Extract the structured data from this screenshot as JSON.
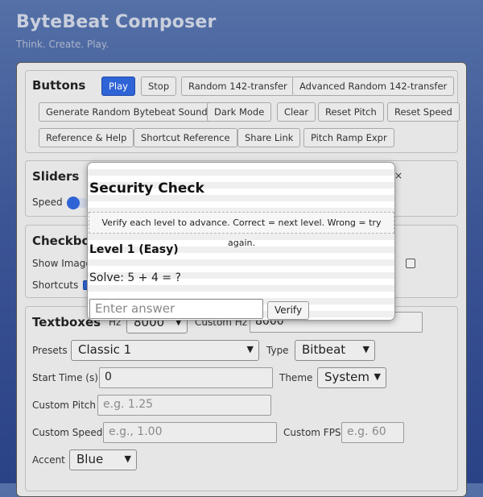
{
  "app": {
    "title": "ByteBeat Composer",
    "subtitle": "Think. Create. Play."
  },
  "buttons": {
    "title": "Buttons",
    "play": "Play",
    "stop": "Stop",
    "random142": "Random 142-transfer",
    "advanced_random142": "Advanced Random 142-transfer",
    "generate_random": "Generate Random Bytebeat Sound",
    "dark_mode": "Dark Mode",
    "clear": "Clear",
    "reset_pitch": "Reset Pitch",
    "reset_speed": "Reset Speed",
    "reference_help": "Reference & Help",
    "shortcut_reference": "Shortcut Reference",
    "share_link": "Share Link",
    "pitch_ramp": "Pitch Ramp Expr"
  },
  "sliders": {
    "title_visible": "Sliders",
    "speed_label": "Speed"
  },
  "checkboxes": {
    "title_visible": "Checkbo",
    "show_image_visible": "Show Image",
    "shortcuts": "Shortcuts",
    "shortcuts_checked": true
  },
  "textboxes": {
    "title": "Textboxes",
    "hz_partial": "Hz",
    "hz_value": "8000",
    "custom_hz_partial": "Custom Hz",
    "custom_hz_value": "8000",
    "presets_label": "Presets",
    "presets_value": "Classic 1",
    "type_label": "Type",
    "type_value": "Bitbeat",
    "start_time_label": "Start Time (s):",
    "start_time_value": "0",
    "theme_label": "Theme",
    "theme_value": "System",
    "custom_pitch_label": "Custom Pitch",
    "custom_pitch_placeholder": "e.g. 1.25",
    "custom_speed_label": "Custom Speed",
    "custom_speed_placeholder": "e.g., 1.00",
    "custom_fps_label": "Custom FPS",
    "custom_fps_placeholder": "e.g. 60",
    "accent_label": "Accent",
    "accent_value": "Blue"
  },
  "modal": {
    "title": "Security Check",
    "close": "×",
    "info": "Verify each level to advance. Correct = next level. Wrong = try again.",
    "level": "Level 1 (Easy)",
    "problem": "Solve: 5 + 4 = ?",
    "input_placeholder": "Enter answer",
    "verify": "Verify"
  },
  "icons": {
    "chevron": "chevron-down-icon",
    "close": "close-icon"
  },
  "colors": {
    "accent": "#2f64d6",
    "background": "#3c5595"
  }
}
